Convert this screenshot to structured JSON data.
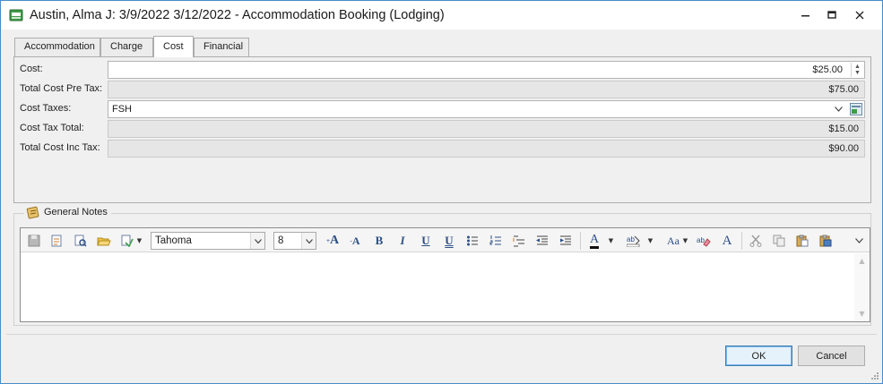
{
  "window": {
    "title": "Austin, Alma J:  3/9/2022 3/12/2022  - Accommodation Booking (Lodging)",
    "icon": "bed-icon",
    "controls": [
      "minimize",
      "maximize",
      "close"
    ]
  },
  "tabs": [
    {
      "label": "Accommodation",
      "active": false
    },
    {
      "label": "Charge",
      "active": false
    },
    {
      "label": "Cost",
      "active": true
    },
    {
      "label": "Financial",
      "active": false
    }
  ],
  "cost_form": {
    "cost": {
      "label": "Cost:",
      "value": "$25.00"
    },
    "total_pre_tax": {
      "label": "Total Cost Pre Tax:",
      "value": "$75.00"
    },
    "cost_taxes": {
      "label": "Cost Taxes:",
      "value": "FSH"
    },
    "cost_tax_total": {
      "label": "Cost Tax Total:",
      "value": "$15.00"
    },
    "total_inc_tax": {
      "label": "Total Cost Inc Tax:",
      "value": "$90.00"
    }
  },
  "notes": {
    "caption": "General Notes",
    "font_name": "Tahoma",
    "font_size": "8",
    "body": ""
  },
  "buttons": {
    "ok": "OK",
    "cancel": "Cancel"
  },
  "colors": {
    "accent": "#3c7fb1",
    "readonly_bg": "#e6e6e6",
    "window_bg": "#f0f0f0"
  }
}
